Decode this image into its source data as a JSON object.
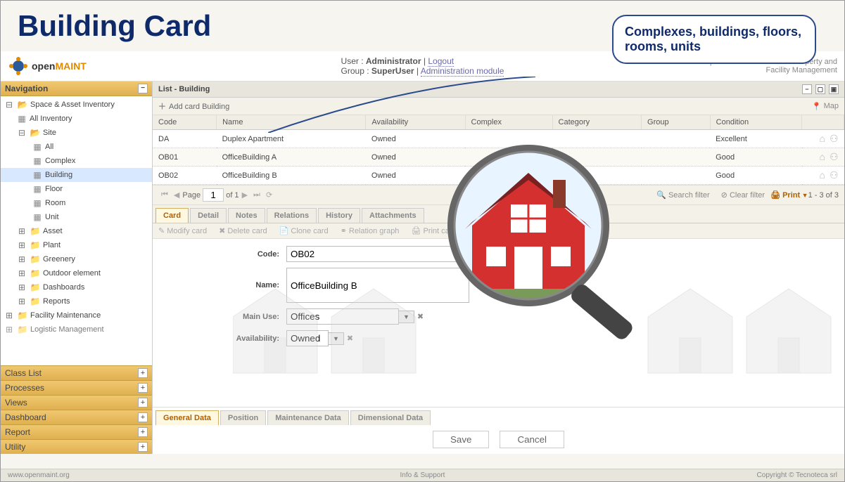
{
  "title": "Building Card",
  "callout": "Complexes, buildings, floors, rooms, units",
  "logo": {
    "part1": "open",
    "part2": "MAINT"
  },
  "tagline": {
    "line1": "Open Source Solution for Property and",
    "line2": "Facility Management"
  },
  "userinfo": {
    "user_label": "User : ",
    "user": "Administrator",
    "logout": "Logout",
    "group_label": "Group : ",
    "group": "SuperUser",
    "admin_link": "Administration module"
  },
  "nav": {
    "title": "Navigation",
    "root": "Space & Asset Inventory",
    "all_inventory": "All Inventory",
    "site": "Site",
    "site_children": [
      "All",
      "Complex",
      "Building",
      "Floor",
      "Room",
      "Unit"
    ],
    "others": [
      "Asset",
      "Plant",
      "Greenery",
      "Outdoor element",
      "Dashboards",
      "Reports"
    ],
    "facility": "Facility Maintenance",
    "logistic": "Logistic Management",
    "accordions": [
      "Class List",
      "Processes",
      "Views",
      "Dashboard",
      "Report",
      "Utility"
    ]
  },
  "list": {
    "title": "List - Building",
    "add_card": "Add card Building",
    "map": "Map",
    "columns": [
      "Code",
      "Name",
      "Availability",
      "Complex",
      "Category",
      "Group",
      "Condition"
    ],
    "rows": [
      {
        "code": "DA",
        "name": "Duplex Apartment",
        "availability": "Owned",
        "complex": "",
        "category": "",
        "group": "",
        "condition": "Excellent"
      },
      {
        "code": "OB01",
        "name": "OfficeBuilding A",
        "availability": "Owned",
        "complex": "",
        "category": "",
        "group": "",
        "condition": "Good"
      },
      {
        "code": "OB02",
        "name": "OfficeBuilding B",
        "availability": "Owned",
        "complex": "",
        "category": "",
        "group": "",
        "condition": "Good"
      }
    ],
    "pager": {
      "page_label": "Page",
      "page": "1",
      "of": "of 1",
      "search": "Search filter",
      "clear": "Clear filter",
      "print": "Print",
      "count": "1 - 3 of 3"
    }
  },
  "detail_tabs": [
    "Card",
    "Detail",
    "Notes",
    "Relations",
    "History",
    "Attachments"
  ],
  "actions": {
    "modify": "Modify card",
    "delete": "Delete card",
    "clone": "Clone card",
    "relgraph": "Relation graph",
    "printcard": "Print card"
  },
  "form": {
    "code_label": "Code:",
    "code": "OB02",
    "name_label": "Name:",
    "name": "OfficeBuilding B",
    "mainuse_label": "Main Use:",
    "mainuse": "Offices",
    "avail_label": "Availability:",
    "avail": "Owned"
  },
  "sub_tabs": [
    "General Data",
    "Position",
    "Maintenance Data",
    "Dimensional Data"
  ],
  "buttons": {
    "save": "Save",
    "cancel": "Cancel"
  },
  "footer": {
    "left": "www.openmaint.org",
    "center": "Info & Support",
    "right": "Copyright © Tecnoteca srl"
  }
}
